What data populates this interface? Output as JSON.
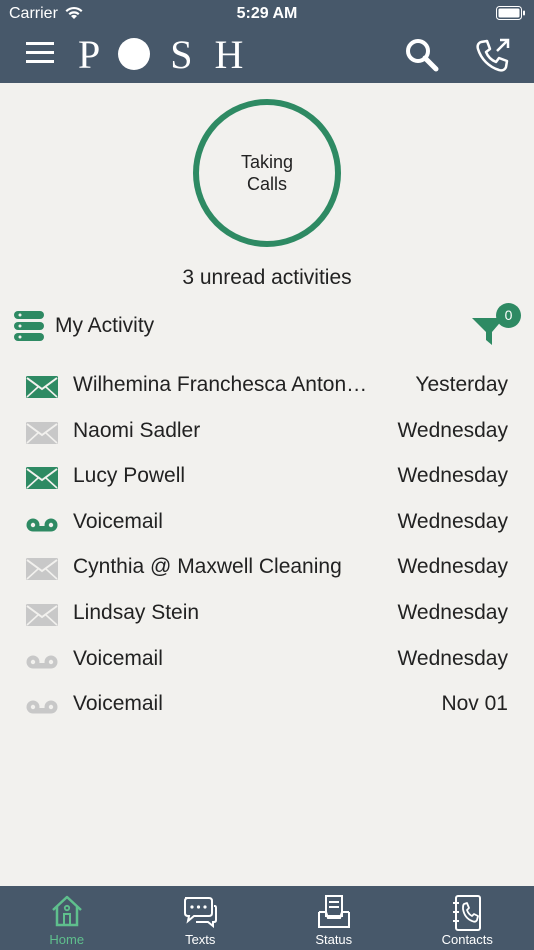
{
  "status_bar": {
    "carrier": "Carrier",
    "time": "5:29 AM"
  },
  "header": {
    "logo": {
      "letters": [
        "P",
        "S",
        "H"
      ]
    },
    "icons": [
      "menu-icon",
      "search-icon",
      "outgoing-call-icon"
    ]
  },
  "call_status": {
    "label": "Taking Calls",
    "ring_color": "#2e8a63"
  },
  "unread_summary": "3 unread activities",
  "activity": {
    "title": "My Activity",
    "filter_count": "0",
    "items": [
      {
        "name": "Wilhemina Franchesca Antonella",
        "date": "Yesterday",
        "type": "message",
        "unread": true
      },
      {
        "name": "Naomi Sadler",
        "date": "Wednesday",
        "type": "message",
        "unread": false
      },
      {
        "name": "Lucy Powell",
        "date": "Wednesday",
        "type": "message",
        "unread": true
      },
      {
        "name": "Voicemail",
        "date": "Wednesday",
        "type": "voicemail",
        "unread": true
      },
      {
        "name": "Cynthia @ Maxwell Cleaning",
        "date": "Wednesday",
        "type": "message",
        "unread": false
      },
      {
        "name": "Lindsay Stein",
        "date": "Wednesday",
        "type": "message",
        "unread": false
      },
      {
        "name": "Voicemail",
        "date": "Wednesday",
        "type": "voicemail",
        "unread": false
      },
      {
        "name": "Voicemail",
        "date": "Nov 01",
        "type": "voicemail",
        "unread": false
      }
    ]
  },
  "tabs": [
    {
      "label": "Home",
      "icon": "home-icon",
      "active": true
    },
    {
      "label": "Texts",
      "icon": "texts-icon",
      "active": false
    },
    {
      "label": "Status",
      "icon": "status-icon",
      "active": false
    },
    {
      "label": "Contacts",
      "icon": "contacts-icon",
      "active": false
    }
  ],
  "colors": {
    "header_bg": "#47586a",
    "accent_green": "#2e8a63",
    "active_tab": "#5fbf8d",
    "read_icon": "#c8c8c8",
    "page_bg": "#f2f1ee"
  }
}
